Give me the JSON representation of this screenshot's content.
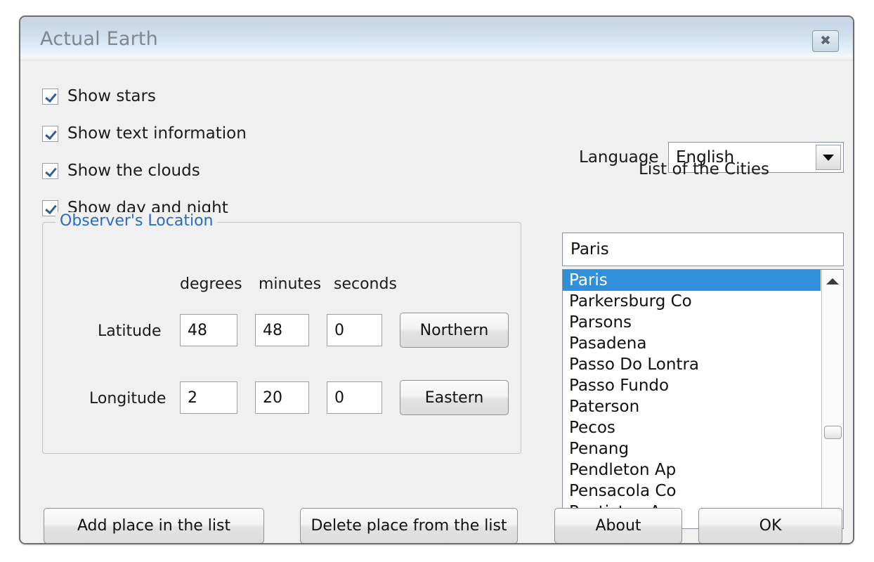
{
  "window": {
    "title": "Actual Earth",
    "close_icon": "close-x-icon"
  },
  "options": {
    "checkboxes": [
      {
        "label": "Show stars",
        "checked": true
      },
      {
        "label": "Show text information",
        "checked": true
      },
      {
        "label": "Show the clouds",
        "checked": true
      },
      {
        "label": "Show day and night",
        "checked": true
      }
    ]
  },
  "observer": {
    "legend": "Observer's Location",
    "columns": [
      "degrees",
      "minutes",
      "seconds"
    ],
    "rows": [
      {
        "label": "Latitude",
        "degrees": "48",
        "minutes": "48",
        "seconds": "0",
        "hemisphere_button": "Northern"
      },
      {
        "label": "Longitude",
        "degrees": "2",
        "minutes": "20",
        "seconds": "0",
        "hemisphere_button": "Eastern"
      }
    ]
  },
  "language": {
    "label": "Language",
    "selected": "English",
    "arrow_icon": "chevron-down-icon"
  },
  "cities": {
    "heading": "List of the Cities",
    "input_value": "Paris",
    "selected": "Paris",
    "items": [
      "Paris",
      "Parkersburg Co",
      "Parsons",
      "Pasadena",
      "Passo Do Lontra",
      "Passo Fundo",
      "Paterson",
      "Pecos",
      "Penang",
      "Pendleton Ap",
      "Pensacola Co",
      "Penticton Ap"
    ],
    "scroll_up_icon": "triangle-up-icon",
    "scroll_down_icon": "triangle-down-icon"
  },
  "footer": {
    "add_place": "Add place in the list",
    "delete_place": "Delete place from the list",
    "about": "About",
    "ok": "OK"
  },
  "colors": {
    "selection": "#2f8fd8",
    "legend_text": "#2b6bbf",
    "dialog_bg": "#f0f0f0",
    "title_text": "#7f878f"
  }
}
